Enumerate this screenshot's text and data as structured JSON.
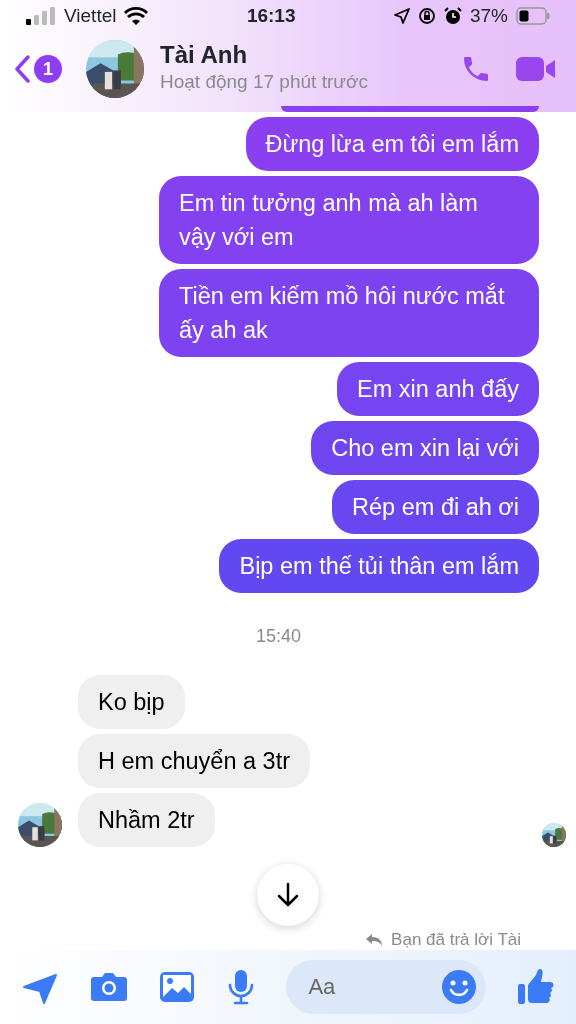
{
  "status_bar": {
    "carrier": "Viettel",
    "time": "16:13",
    "battery": "37%"
  },
  "header": {
    "back_count": "1",
    "name": "Tài Anh",
    "status": "Hoạt động 17 phút trước"
  },
  "messages": [
    {
      "kind": "outgoing",
      "text": "Đừng lừa em tôi em lắm"
    },
    {
      "kind": "outgoing",
      "text": "Em tin tưởng anh mà ah làm vậy với em"
    },
    {
      "kind": "outgoing",
      "text": "Tiền em kiếm mồ hôi nước mắt ấy ah ak"
    },
    {
      "kind": "outgoing",
      "text": "Em xin anh đấy"
    },
    {
      "kind": "outgoing",
      "text": "Cho em xin lại với"
    },
    {
      "kind": "outgoing",
      "text": "Rép em đi ah ơi"
    },
    {
      "kind": "outgoing",
      "text": "Bịp em thế tủi thân em lắm"
    },
    {
      "kind": "timestamp",
      "text": "15:40"
    },
    {
      "kind": "incoming",
      "text": "Ko bịp"
    },
    {
      "kind": "incoming",
      "text": "H em chuyển a 3tr"
    },
    {
      "kind": "incoming",
      "text": "Nhầm 2tr"
    }
  ],
  "reply_note": "Bạn đã trả lời Tài",
  "composer": {
    "placeholder": "Aa"
  }
}
